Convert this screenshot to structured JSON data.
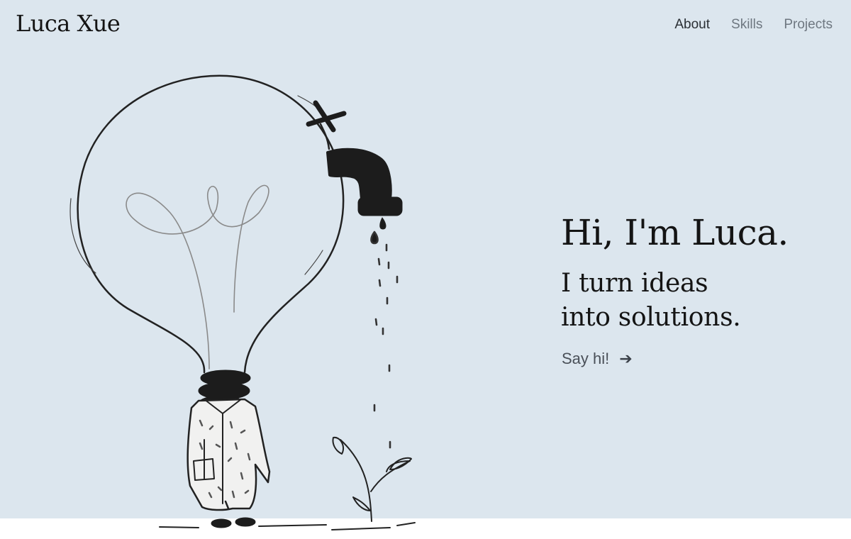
{
  "brand": {
    "name": "Luca Xue"
  },
  "nav": {
    "items": [
      {
        "label": "About",
        "active": true
      },
      {
        "label": "Skills",
        "active": false
      },
      {
        "label": "Projects",
        "active": false
      }
    ]
  },
  "hero": {
    "headline": "Hi, I'm Luca.",
    "tagline_line1": "I turn ideas",
    "tagline_line2": "into solutions.",
    "cta_label": "Say hi!",
    "cta_icon": "arrow-right-icon",
    "illustration": "lightbulb-faucet-person-sprout"
  },
  "colors": {
    "hero_bg": "#dce6ee",
    "page_bg": "#ffffff",
    "text_dark": "#141414",
    "nav_muted": "#6e7780"
  }
}
